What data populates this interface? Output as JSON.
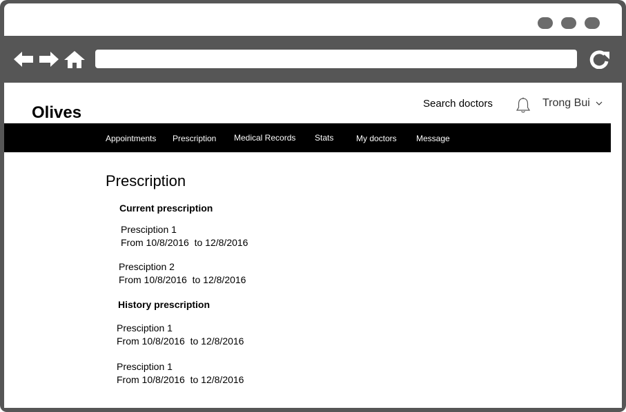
{
  "browser": {
    "window_controls": [
      "window-dot-1",
      "window-dot-2",
      "window-dot-3"
    ],
    "nav_icons": [
      "back-arrow-icon",
      "forward-arrow-icon",
      "home-icon",
      "reload-icon"
    ],
    "address_value": ""
  },
  "header": {
    "brand": "Olives",
    "search_label": "Search doctors",
    "notification_icon": "bell-icon",
    "user_name": "Trong Bui",
    "user_menu_icon": "chevron-down-icon"
  },
  "nav": {
    "items": [
      {
        "label": "Appointments"
      },
      {
        "label": "Prescription"
      },
      {
        "label": "Medical Records"
      },
      {
        "label": "Stats"
      },
      {
        "label": "My doctors"
      },
      {
        "label": "Message"
      }
    ]
  },
  "main": {
    "title": "Prescription",
    "current": {
      "heading": "Current prescription",
      "items": [
        {
          "name": "Presciption 1",
          "dates": "From 10/8/2016  to 12/8/2016"
        },
        {
          "name": "Presciption 2",
          "dates": "From 10/8/2016  to 12/8/2016"
        }
      ]
    },
    "history": {
      "heading": "History prescription",
      "items": [
        {
          "name": "Presciption 1",
          "dates": "From 10/8/2016  to 12/8/2016"
        },
        {
          "name": "Presciption 1",
          "dates": "From 10/8/2016  to 12/8/2016"
        }
      ]
    }
  },
  "colors": {
    "chrome": "#565656",
    "navbar": "#000000",
    "page": "#ffffff"
  }
}
